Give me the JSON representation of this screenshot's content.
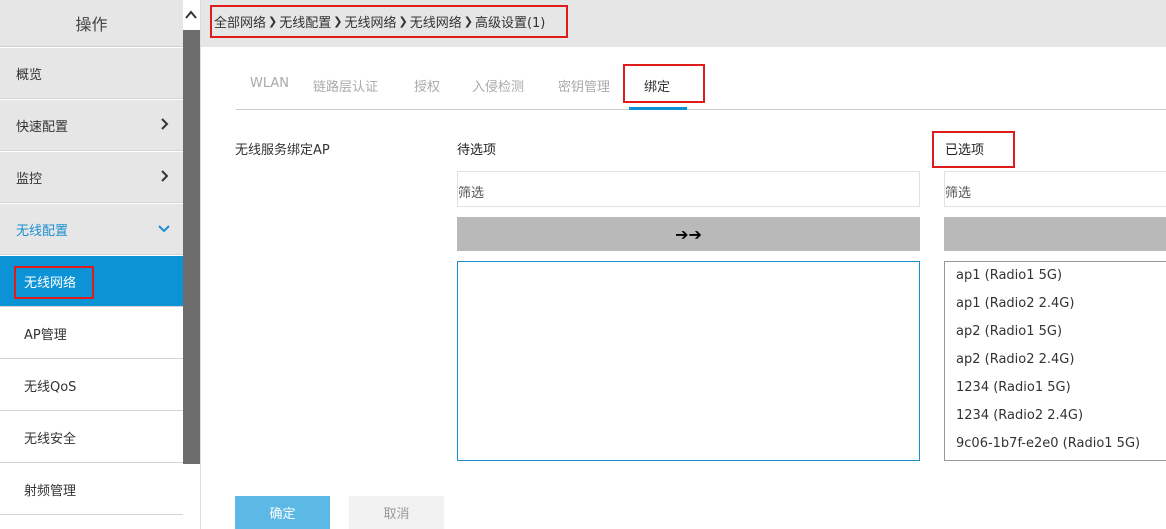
{
  "sidebar": {
    "header": "操作",
    "items": [
      {
        "label": "概览"
      },
      {
        "label": "快速配置"
      },
      {
        "label": "监控"
      },
      {
        "label": "无线配置"
      },
      {
        "label": "无线网络"
      },
      {
        "label": "AP管理"
      },
      {
        "label": "无线QoS"
      },
      {
        "label": "无线安全"
      },
      {
        "label": "射频管理"
      }
    ]
  },
  "breadcrumb": [
    "全部网络",
    "无线配置",
    "无线网络",
    "无线网络",
    "高级设置(1)"
  ],
  "tabs": [
    {
      "label": "WLAN"
    },
    {
      "label": "链路层认证"
    },
    {
      "label": "授权"
    },
    {
      "label": "入侵检测"
    },
    {
      "label": "密钥管理"
    },
    {
      "label": "绑定"
    }
  ],
  "form": {
    "field_label": "无线服务绑定AP",
    "available_title": "待选项",
    "selected_title": "已选项",
    "available_filter_placeholder": "筛选",
    "selected_filter_placeholder": "筛选",
    "move_right_glyph": "➔➔",
    "selected_items": [
      "ap1 (Radio1 5G)",
      "ap1 (Radio2 2.4G)",
      "ap2 (Radio1 5G)",
      "ap2 (Radio2 2.4G)",
      "1234 (Radio1 5G)",
      "1234 (Radio2 2.4G)",
      "9c06-1b7f-e2e0 (Radio1 5G)"
    ]
  },
  "buttons": {
    "ok": "确定",
    "cancel": "取消"
  },
  "colors": {
    "accent": "#0c93d6",
    "highlight": "#e01b1b"
  }
}
